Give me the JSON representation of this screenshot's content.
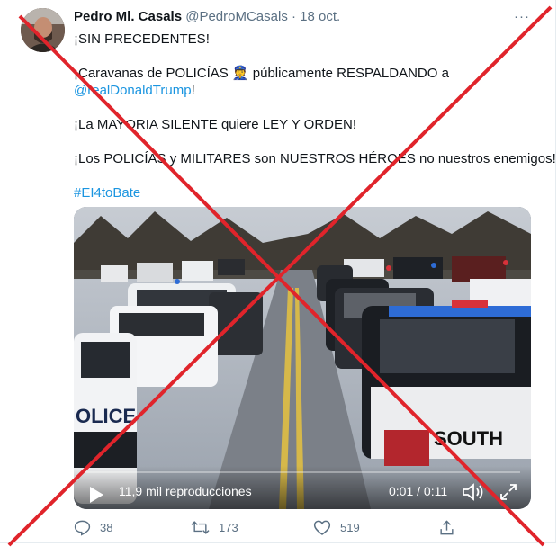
{
  "author": {
    "name": "Pedro Ml. Casals",
    "handle": "@PedroMCasals",
    "separator": "·",
    "date": "18 oct."
  },
  "more_label": "···",
  "body": {
    "line1": "¡SIN PRECEDENTES!",
    "line2_a": "¡Caravanas de POLICÍAS ",
    "line2_emoji": "👮",
    "line2_b": " públicamente RESPALDANDO a",
    "line3_link": "@realDonaldTrump",
    "line3_end": "!",
    "line4": "¡La MAYORIA SILENTE quiere LEY Y ORDEN!",
    "line5": "¡Los POLICÍAS y MILITARES son NUESTROS HÉROES no nuestros enemigos!",
    "hashtag": "#EI4toBate"
  },
  "media": {
    "views": "11,9 mil reproducciones",
    "time": "0:01 / 0:11",
    "vehicle_text": "SOUTH",
    "car_text_left": "OLICE"
  },
  "actions": {
    "reply_count": "38",
    "retweet_count": "173",
    "like_count": "519"
  },
  "colors": {
    "accent": "#1b95e0",
    "secondary": "#5b7083",
    "cross": "#e0242b"
  }
}
